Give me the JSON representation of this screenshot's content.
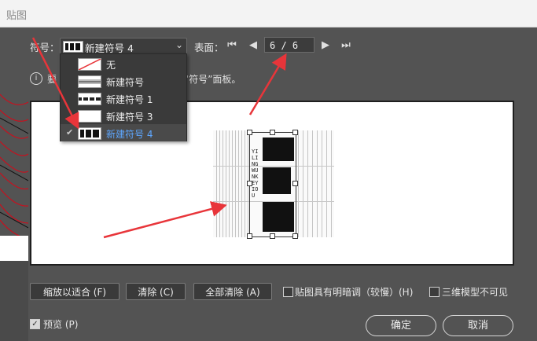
{
  "window": {
    "title": "贴图"
  },
  "symbol": {
    "label": "符号：",
    "selected": "新建符号 4"
  },
  "surface": {
    "label": "表面：",
    "page": "6 / 6"
  },
  "info": {
    "text_left": "要",
    "text_right": "“符号”面板。"
  },
  "dropdown": {
    "items": [
      {
        "label": "无"
      },
      {
        "label": "新建符号"
      },
      {
        "label": "新建符号 1"
      },
      {
        "label": "新建符号 3"
      },
      {
        "label": "新建符号 4"
      }
    ]
  },
  "artwork": {
    "vertical_text": "YILINGWUNKEYIOU"
  },
  "buttons": {
    "fit": "缩放以适合 (F)",
    "clear": "清除 (C)",
    "clear_all": "全部清除 (A)",
    "ok": "确定",
    "cancel": "取消"
  },
  "checkboxes": {
    "shade": "贴图具有明暗调（较慢）(H)",
    "invisible": "三维模型不可见",
    "preview": "预览 (P)",
    "preview_checked": true
  },
  "colors": {
    "accent_selected": "#5ea7ff",
    "arrow": "#e8353a",
    "bg": "#535353"
  }
}
